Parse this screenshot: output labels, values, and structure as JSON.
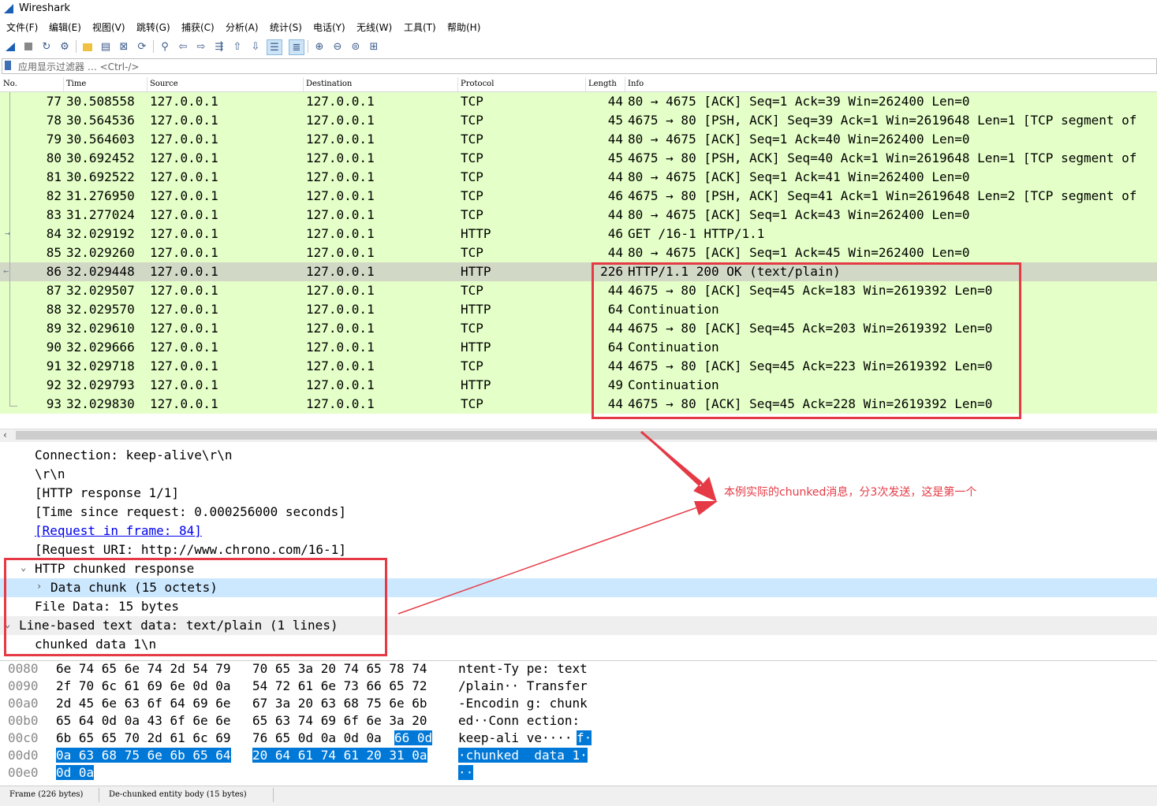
{
  "window": {
    "title": "Wireshark"
  },
  "menu": [
    "文件(F)",
    "编辑(E)",
    "视图(V)",
    "跳转(G)",
    "捕获(C)",
    "分析(A)",
    "统计(S)",
    "电话(Y)",
    "无线(W)",
    "工具(T)",
    "帮助(H)"
  ],
  "toolbar": {
    "icons": [
      "shark-fin-icon",
      "stop-icon",
      "restart-icon",
      "options-gear-icon",
      "open-folder-icon",
      "file-icon",
      "close-file-icon",
      "reload-icon",
      "find-icon",
      "back-arrow-icon",
      "forward-arrow-icon",
      "goto-packet-icon",
      "first-packet-icon",
      "last-packet-icon",
      "autoscroll-icon",
      "colorize-icon",
      "zoom-in-icon",
      "zoom-out-icon",
      "normal-size-icon",
      "resize-columns-icon"
    ]
  },
  "filter": {
    "placeholder": "应用显示过滤器 … <Ctrl-/>"
  },
  "packet_list": {
    "columns": [
      "No.",
      "Time",
      "Source",
      "Destination",
      "Protocol",
      "Length",
      "Info"
    ],
    "rows": [
      {
        "no": "77",
        "time": "30.508558",
        "src": "127.0.0.1",
        "dst": "127.0.0.1",
        "proto": "TCP",
        "len": "44",
        "info": "80 → 4675 [ACK] Seq=1 Ack=39 Win=262400 Len=0"
      },
      {
        "no": "78",
        "time": "30.564536",
        "src": "127.0.0.1",
        "dst": "127.0.0.1",
        "proto": "TCP",
        "len": "45",
        "info": "4675 → 80 [PSH, ACK] Seq=39 Ack=1 Win=2619648 Len=1 [TCP segment of"
      },
      {
        "no": "79",
        "time": "30.564603",
        "src": "127.0.0.1",
        "dst": "127.0.0.1",
        "proto": "TCP",
        "len": "44",
        "info": "80 → 4675 [ACK] Seq=1 Ack=40 Win=262400 Len=0"
      },
      {
        "no": "80",
        "time": "30.692452",
        "src": "127.0.0.1",
        "dst": "127.0.0.1",
        "proto": "TCP",
        "len": "45",
        "info": "4675 → 80 [PSH, ACK] Seq=40 Ack=1 Win=2619648 Len=1 [TCP segment of"
      },
      {
        "no": "81",
        "time": "30.692522",
        "src": "127.0.0.1",
        "dst": "127.0.0.1",
        "proto": "TCP",
        "len": "44",
        "info": "80 → 4675 [ACK] Seq=1 Ack=41 Win=262400 Len=0"
      },
      {
        "no": "82",
        "time": "31.276950",
        "src": "127.0.0.1",
        "dst": "127.0.0.1",
        "proto": "TCP",
        "len": "46",
        "info": "4675 → 80 [PSH, ACK] Seq=41 Ack=1 Win=2619648 Len=2 [TCP segment of"
      },
      {
        "no": "83",
        "time": "31.277024",
        "src": "127.0.0.1",
        "dst": "127.0.0.1",
        "proto": "TCP",
        "len": "44",
        "info": "80 → 4675 [ACK] Seq=1 Ack=43 Win=262400 Len=0"
      },
      {
        "no": "84",
        "time": "32.029192",
        "src": "127.0.0.1",
        "dst": "127.0.0.1",
        "proto": "HTTP",
        "len": "46",
        "info": "GET /16-1 HTTP/1.1"
      },
      {
        "no": "85",
        "time": "32.029260",
        "src": "127.0.0.1",
        "dst": "127.0.0.1",
        "proto": "TCP",
        "len": "44",
        "info": "80 → 4675 [ACK] Seq=1 Ack=45 Win=262400 Len=0"
      },
      {
        "no": "86",
        "time": "32.029448",
        "src": "127.0.0.1",
        "dst": "127.0.0.1",
        "proto": "HTTP",
        "len": "226",
        "info": "HTTP/1.1 200 OK  (text/plain)"
      },
      {
        "no": "87",
        "time": "32.029507",
        "src": "127.0.0.1",
        "dst": "127.0.0.1",
        "proto": "TCP",
        "len": "44",
        "info": "4675 → 80 [ACK] Seq=45 Ack=183 Win=2619392 Len=0"
      },
      {
        "no": "88",
        "time": "32.029570",
        "src": "127.0.0.1",
        "dst": "127.0.0.1",
        "proto": "HTTP",
        "len": "64",
        "info": "Continuation"
      },
      {
        "no": "89",
        "time": "32.029610",
        "src": "127.0.0.1",
        "dst": "127.0.0.1",
        "proto": "TCP",
        "len": "44",
        "info": "4675 → 80 [ACK] Seq=45 Ack=203 Win=2619392 Len=0"
      },
      {
        "no": "90",
        "time": "32.029666",
        "src": "127.0.0.1",
        "dst": "127.0.0.1",
        "proto": "HTTP",
        "len": "64",
        "info": "Continuation"
      },
      {
        "no": "91",
        "time": "32.029718",
        "src": "127.0.0.1",
        "dst": "127.0.0.1",
        "proto": "TCP",
        "len": "44",
        "info": "4675 → 80 [ACK] Seq=45 Ack=223 Win=2619392 Len=0"
      },
      {
        "no": "92",
        "time": "32.029793",
        "src": "127.0.0.1",
        "dst": "127.0.0.1",
        "proto": "HTTP",
        "len": "49",
        "info": "Continuation"
      },
      {
        "no": "93",
        "time": "32.029830",
        "src": "127.0.0.1",
        "dst": "127.0.0.1",
        "proto": "TCP",
        "len": "44",
        "info": "4675 → 80 [ACK] Seq=45 Ack=228 Win=2619392 Len=0"
      }
    ],
    "selected_no": "86",
    "row_color": "#e4ffc7",
    "selected_row_color": "#d2d8c6"
  },
  "details": {
    "lines": [
      "Connection: keep-alive\\r\\n",
      "\\r\\n",
      "[HTTP response 1/1]",
      "[Time since request: 0.000256000 seconds]",
      "[Request in frame: 84]",
      "[Request URI: http://www.chrono.com/16-1]",
      "HTTP chunked response",
      "Data chunk (15 octets)",
      "File Data: 15 bytes",
      "Line-based text data: text/plain (1 lines)",
      "chunked data 1\\n"
    ]
  },
  "bytes": {
    "rows": [
      {
        "off": "0080",
        "hex1": "6e 74 65 6e 74 2d 54 79",
        "hex2": "70 65 3a 20 74 65 78 74",
        "asc": "ntent-Ty pe: text"
      },
      {
        "off": "0090",
        "hex1": "2f 70 6c 61 69 6e 0d 0a",
        "hex2": "54 72 61 6e 73 66 65 72",
        "asc": "/plain·· Transfer"
      },
      {
        "off": "00a0",
        "hex1": "2d 45 6e 63 6f 64 69 6e",
        "hex2": "67 3a 20 63 68 75 6e 6b",
        "asc": "-Encodin g: chunk"
      },
      {
        "off": "00b0",
        "hex1": "65 64 0d 0a 43 6f 6e 6e",
        "hex2": "65 63 74 69 6f 6e 3a 20",
        "asc": "ed··Conn ection: "
      },
      {
        "off": "00c0",
        "hex1": "6b 65 65 70 2d 61 6c 69",
        "hex2": "76 65 0d 0a 0d 0a",
        "hex2_sel": "66 0d",
        "asc": "keep-ali ve····",
        "asc_sel": "f·"
      },
      {
        "off": "00d0",
        "hex1_sel": "0a 63 68 75 6e 6b 65 64",
        "hex2_sel": "20 64 61 74 61 20 31 0a",
        "asc_sel": "·chunked  data 1·"
      },
      {
        "off": "00e0",
        "hex1_sel": "0d 0a",
        "asc_sel": "··"
      }
    ],
    "selection_color": "#0078d7"
  },
  "status": {
    "tabs": [
      "Frame (226 bytes)",
      "De-chunked entity body (15 bytes)"
    ]
  },
  "annotation": {
    "note": "本例实际的chunked消息，分3次发送，这是第一个",
    "color": "#e53a45"
  }
}
